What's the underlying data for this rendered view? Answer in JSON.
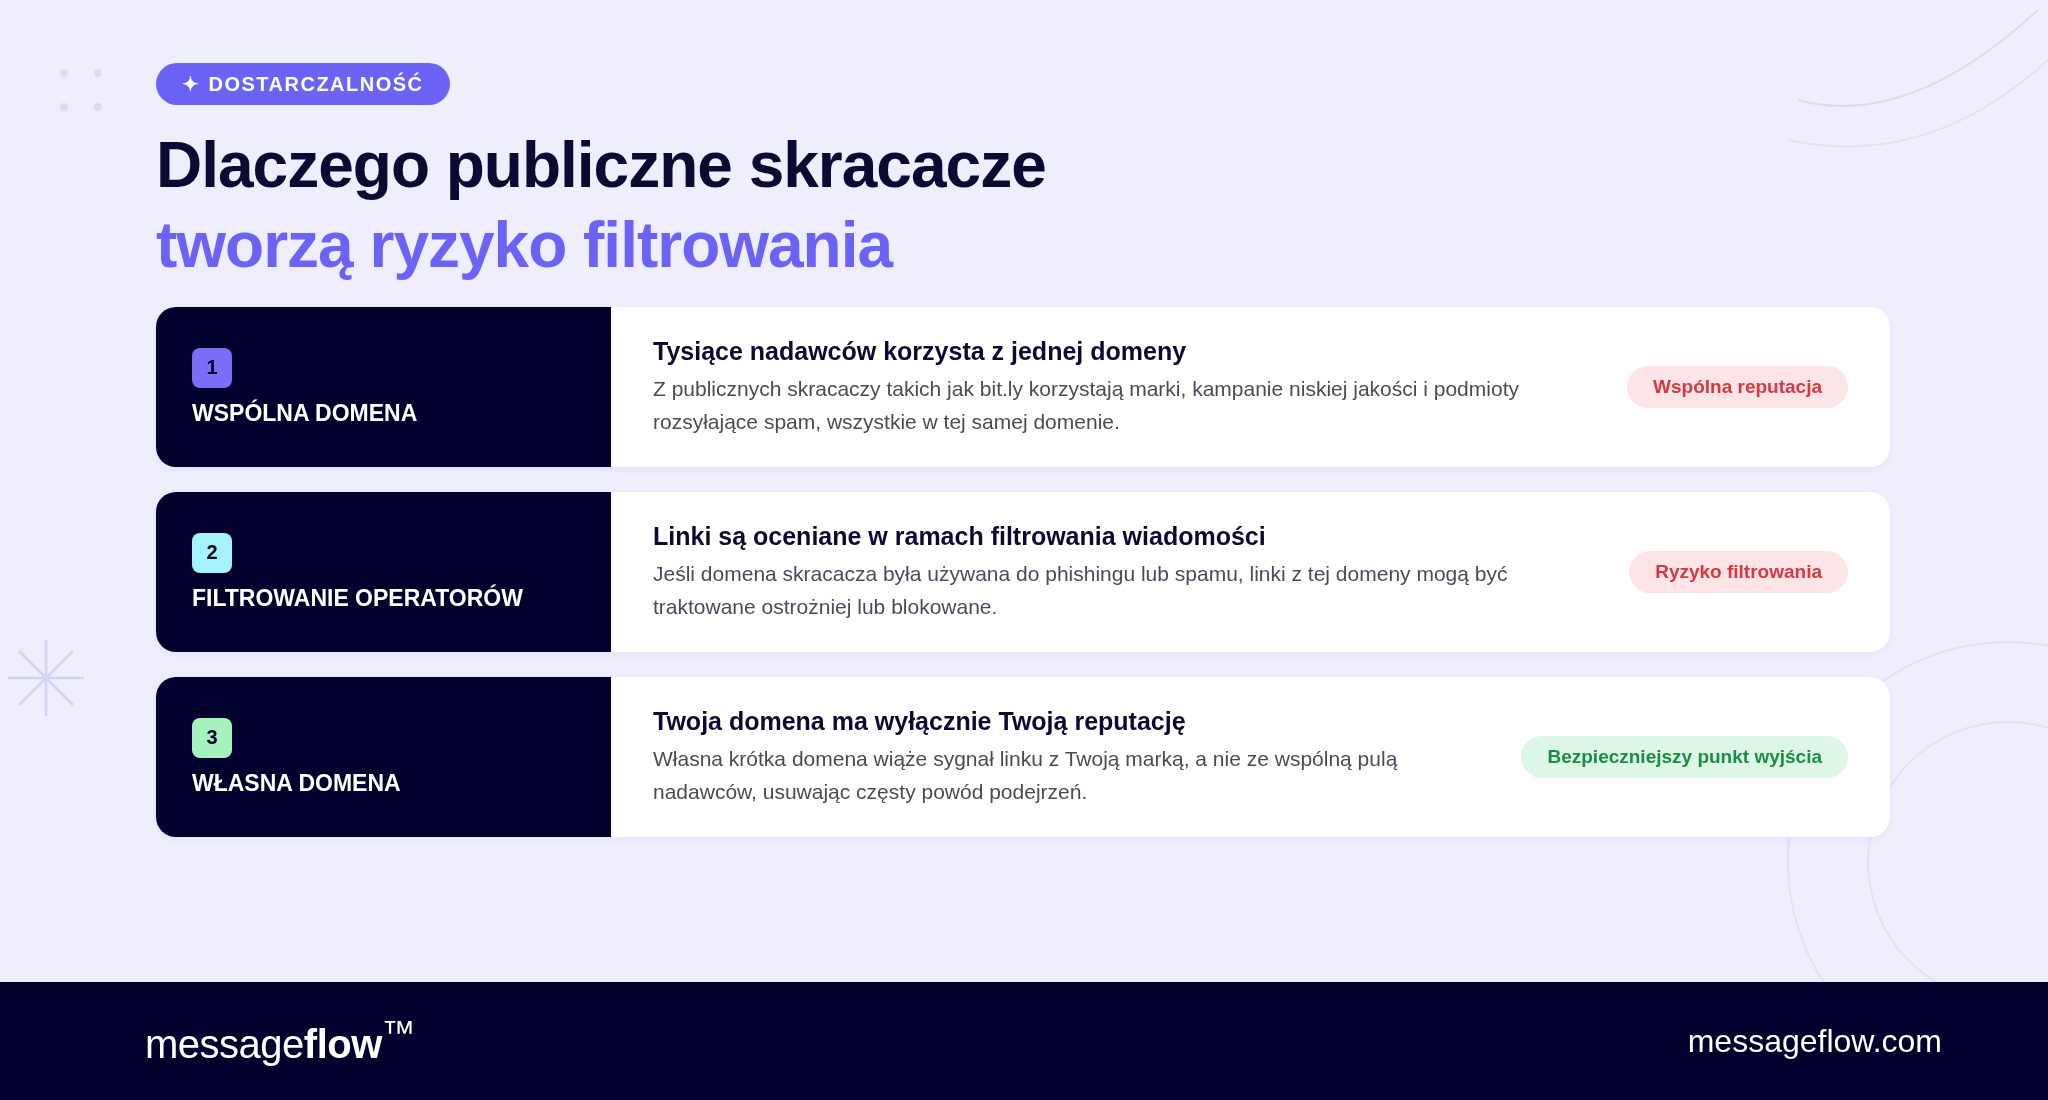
{
  "badge": {
    "icon": "✦",
    "label": "DOSTARCZALNOŚĆ"
  },
  "title": {
    "line_1": "Dlaczego publiczne skracacze",
    "line_2": "tworzą ryzyko filtrowania"
  },
  "cards": [
    {
      "number": "1",
      "color": "#7b6ef6",
      "label": "WSPÓLNA DOMENA",
      "heading": "Tysiące nadawców korzysta z jednej domeny",
      "text": "Z publicznych skracaczy takich jak bit.ly korzystają marki, kampanie niskiej jakości i podmioty rozsyłające spam, wszystkie w tej samej domenie.",
      "tag": {
        "kind": "risk",
        "label": "Wspólna reputacja"
      }
    },
    {
      "number": "2",
      "color": "#a5f3fc",
      "label": "FILTROWANIE OPERATORÓW",
      "heading": "Linki są oceniane w ramach filtrowania wiadomości",
      "text": "Jeśli domena skracacza była używana do phishingu lub spamu, linki z tej domeny mogą być traktowane ostrożniej lub blokowane.",
      "tag": {
        "kind": "risk",
        "label": "Ryzyko filtrowania"
      }
    },
    {
      "number": "3",
      "color": "#a7f3c0",
      "label": "WŁASNA DOMENA",
      "heading": "Twoja domena ma wyłącznie Twoją reputację",
      "text": "Własna krótka domena wiąże sygnał linku z Twoją marką, a nie ze wspólną pulą nadawców, usuwając częsty powód podejrzeń.",
      "tag": {
        "kind": "safe",
        "label": "Bezpieczniejszy punkt wyjścia"
      }
    }
  ],
  "footer": {
    "logo": "message**flow**$^{™}$",
    "url": "messageflow.com"
  }
}
